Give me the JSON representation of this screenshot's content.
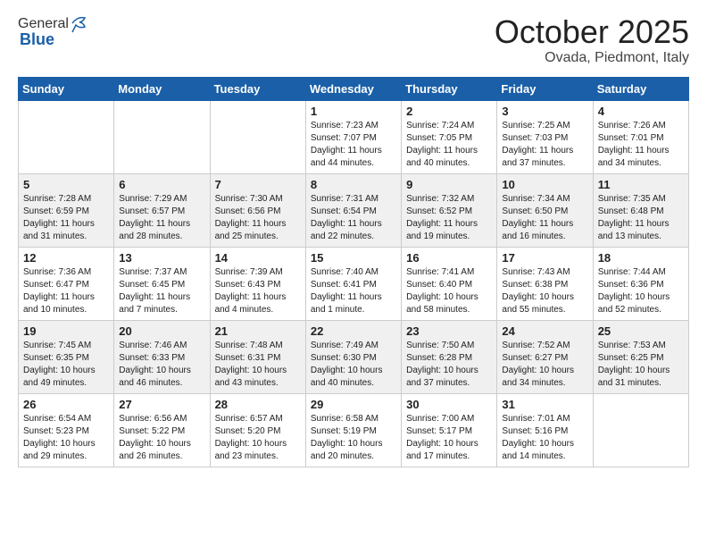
{
  "logo": {
    "general": "General",
    "blue": "Blue"
  },
  "title": "October 2025",
  "subtitle": "Ovada, Piedmont, Italy",
  "days_of_week": [
    "Sunday",
    "Monday",
    "Tuesday",
    "Wednesday",
    "Thursday",
    "Friday",
    "Saturday"
  ],
  "weeks": [
    {
      "shaded": false,
      "days": [
        {
          "num": "",
          "info": ""
        },
        {
          "num": "",
          "info": ""
        },
        {
          "num": "",
          "info": ""
        },
        {
          "num": "1",
          "info": "Sunrise: 7:23 AM\nSunset: 7:07 PM\nDaylight: 11 hours\nand 44 minutes."
        },
        {
          "num": "2",
          "info": "Sunrise: 7:24 AM\nSunset: 7:05 PM\nDaylight: 11 hours\nand 40 minutes."
        },
        {
          "num": "3",
          "info": "Sunrise: 7:25 AM\nSunset: 7:03 PM\nDaylight: 11 hours\nand 37 minutes."
        },
        {
          "num": "4",
          "info": "Sunrise: 7:26 AM\nSunset: 7:01 PM\nDaylight: 11 hours\nand 34 minutes."
        }
      ]
    },
    {
      "shaded": true,
      "days": [
        {
          "num": "5",
          "info": "Sunrise: 7:28 AM\nSunset: 6:59 PM\nDaylight: 11 hours\nand 31 minutes."
        },
        {
          "num": "6",
          "info": "Sunrise: 7:29 AM\nSunset: 6:57 PM\nDaylight: 11 hours\nand 28 minutes."
        },
        {
          "num": "7",
          "info": "Sunrise: 7:30 AM\nSunset: 6:56 PM\nDaylight: 11 hours\nand 25 minutes."
        },
        {
          "num": "8",
          "info": "Sunrise: 7:31 AM\nSunset: 6:54 PM\nDaylight: 11 hours\nand 22 minutes."
        },
        {
          "num": "9",
          "info": "Sunrise: 7:32 AM\nSunset: 6:52 PM\nDaylight: 11 hours\nand 19 minutes."
        },
        {
          "num": "10",
          "info": "Sunrise: 7:34 AM\nSunset: 6:50 PM\nDaylight: 11 hours\nand 16 minutes."
        },
        {
          "num": "11",
          "info": "Sunrise: 7:35 AM\nSunset: 6:48 PM\nDaylight: 11 hours\nand 13 minutes."
        }
      ]
    },
    {
      "shaded": false,
      "days": [
        {
          "num": "12",
          "info": "Sunrise: 7:36 AM\nSunset: 6:47 PM\nDaylight: 11 hours\nand 10 minutes."
        },
        {
          "num": "13",
          "info": "Sunrise: 7:37 AM\nSunset: 6:45 PM\nDaylight: 11 hours\nand 7 minutes."
        },
        {
          "num": "14",
          "info": "Sunrise: 7:39 AM\nSunset: 6:43 PM\nDaylight: 11 hours\nand 4 minutes."
        },
        {
          "num": "15",
          "info": "Sunrise: 7:40 AM\nSunset: 6:41 PM\nDaylight: 11 hours\nand 1 minute."
        },
        {
          "num": "16",
          "info": "Sunrise: 7:41 AM\nSunset: 6:40 PM\nDaylight: 10 hours\nand 58 minutes."
        },
        {
          "num": "17",
          "info": "Sunrise: 7:43 AM\nSunset: 6:38 PM\nDaylight: 10 hours\nand 55 minutes."
        },
        {
          "num": "18",
          "info": "Sunrise: 7:44 AM\nSunset: 6:36 PM\nDaylight: 10 hours\nand 52 minutes."
        }
      ]
    },
    {
      "shaded": true,
      "days": [
        {
          "num": "19",
          "info": "Sunrise: 7:45 AM\nSunset: 6:35 PM\nDaylight: 10 hours\nand 49 minutes."
        },
        {
          "num": "20",
          "info": "Sunrise: 7:46 AM\nSunset: 6:33 PM\nDaylight: 10 hours\nand 46 minutes."
        },
        {
          "num": "21",
          "info": "Sunrise: 7:48 AM\nSunset: 6:31 PM\nDaylight: 10 hours\nand 43 minutes."
        },
        {
          "num": "22",
          "info": "Sunrise: 7:49 AM\nSunset: 6:30 PM\nDaylight: 10 hours\nand 40 minutes."
        },
        {
          "num": "23",
          "info": "Sunrise: 7:50 AM\nSunset: 6:28 PM\nDaylight: 10 hours\nand 37 minutes."
        },
        {
          "num": "24",
          "info": "Sunrise: 7:52 AM\nSunset: 6:27 PM\nDaylight: 10 hours\nand 34 minutes."
        },
        {
          "num": "25",
          "info": "Sunrise: 7:53 AM\nSunset: 6:25 PM\nDaylight: 10 hours\nand 31 minutes."
        }
      ]
    },
    {
      "shaded": false,
      "days": [
        {
          "num": "26",
          "info": "Sunrise: 6:54 AM\nSunset: 5:23 PM\nDaylight: 10 hours\nand 29 minutes."
        },
        {
          "num": "27",
          "info": "Sunrise: 6:56 AM\nSunset: 5:22 PM\nDaylight: 10 hours\nand 26 minutes."
        },
        {
          "num": "28",
          "info": "Sunrise: 6:57 AM\nSunset: 5:20 PM\nDaylight: 10 hours\nand 23 minutes."
        },
        {
          "num": "29",
          "info": "Sunrise: 6:58 AM\nSunset: 5:19 PM\nDaylight: 10 hours\nand 20 minutes."
        },
        {
          "num": "30",
          "info": "Sunrise: 7:00 AM\nSunset: 5:17 PM\nDaylight: 10 hours\nand 17 minutes."
        },
        {
          "num": "31",
          "info": "Sunrise: 7:01 AM\nSunset: 5:16 PM\nDaylight: 10 hours\nand 14 minutes."
        },
        {
          "num": "",
          "info": ""
        }
      ]
    }
  ]
}
